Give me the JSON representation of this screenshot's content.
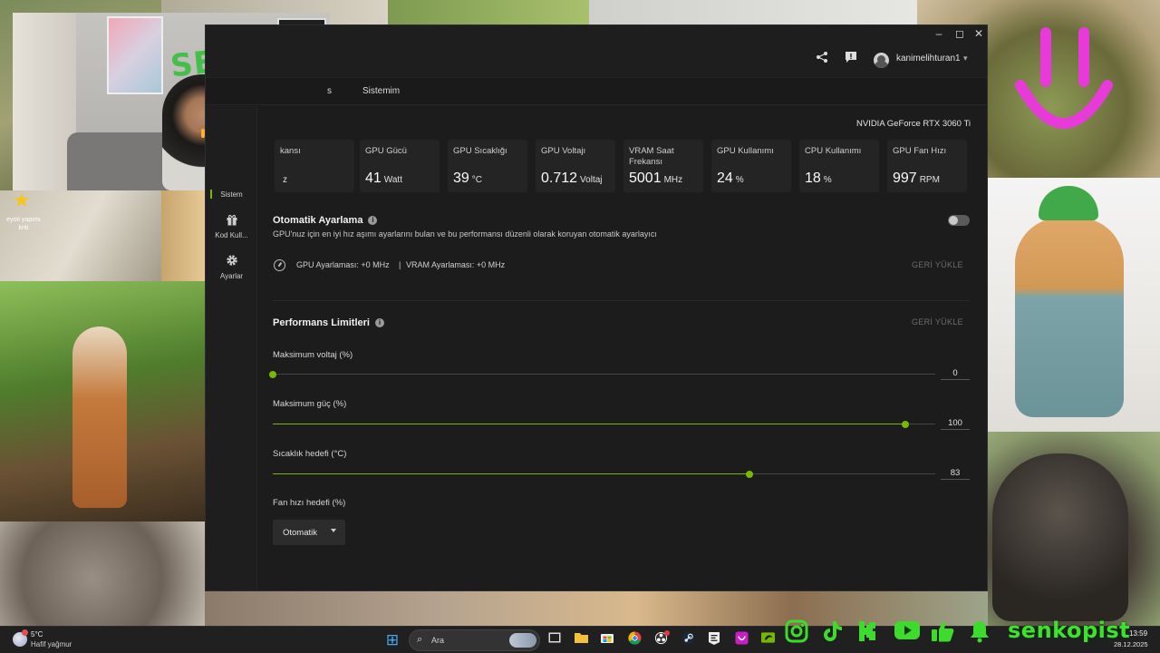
{
  "window": {
    "controls": {
      "minimize": "–",
      "maximize": "◻",
      "close": "✕"
    },
    "user": "kanimelihturan1"
  },
  "tabs": {
    "items": [
      "s",
      "Sistemim"
    ]
  },
  "gpu_name": "NVIDIA GeForce RTX 3060 Ti",
  "stats": [
    {
      "label": "kansı",
      "value": "",
      "unit": "z"
    },
    {
      "label": "GPU Gücü",
      "value": "41",
      "unit": "Watt"
    },
    {
      "label": "GPU Sıcaklığı",
      "value": "39",
      "unit": "°C"
    },
    {
      "label": "GPU Voltajı",
      "value": "0.712",
      "unit": "Voltaj"
    },
    {
      "label": "VRAM Saat Frekansı",
      "value": "5001",
      "unit": "MHz"
    },
    {
      "label": "GPU Kullanımı",
      "value": "24",
      "unit": "%"
    },
    {
      "label": "CPU Kullanımı",
      "value": "18",
      "unit": "%"
    },
    {
      "label": "GPU Fan Hızı",
      "value": "997",
      "unit": "RPM"
    }
  ],
  "sidebar": {
    "items": [
      {
        "label": "Sistem",
        "icon": "monitor-icon"
      },
      {
        "label": "Kod Kull...",
        "icon": "gift-icon"
      },
      {
        "label": "Ayarlar",
        "icon": "gear-icon"
      }
    ]
  },
  "auto_tuning": {
    "title": "Otomatik Ayarlama",
    "description": "GPU'nuz için en iyi hız aşımı ayarlarını bulan ve bu performansı düzenli olarak koruyan otomatik ayarlayıcı",
    "enabled": false,
    "gpu_offset": "GPU Ayarlaması: +0 MHz",
    "separator": "|",
    "vram_offset": "VRAM Ayarlaması: +0 MHz",
    "reset": "GERİ YÜKLE"
  },
  "limits": {
    "title": "Performans Limitleri",
    "reset": "GERİ YÜKLE",
    "sliders": [
      {
        "label": "Maksimum voltaj (%)",
        "value": "0",
        "fraction": 0.0
      },
      {
        "label": "Maksimum güç (%)",
        "value": "100",
        "fraction": 0.955
      },
      {
        "label": "Sıcaklık hedefi (°C)",
        "value": "83",
        "fraction": 0.72
      }
    ],
    "fan": {
      "label": "Fan hızı hedefi (%)",
      "selected": "Otomatik"
    }
  },
  "taskbar": {
    "weather_temp": "5°C",
    "weather_desc": "Hafif yağmur",
    "search_placeholder": "Ara",
    "start_icon": "⊞",
    "brand": "senkopist",
    "time": "13:59",
    "date": "28.12.2025"
  },
  "overlay": {
    "cam_logo": "SEKO",
    "avatar_caption": "eyoti yapımı kriti"
  },
  "colors": {
    "accent": "#76b900",
    "social_green": "#3ddc2c",
    "smiley_pink": "#e83ad8"
  }
}
